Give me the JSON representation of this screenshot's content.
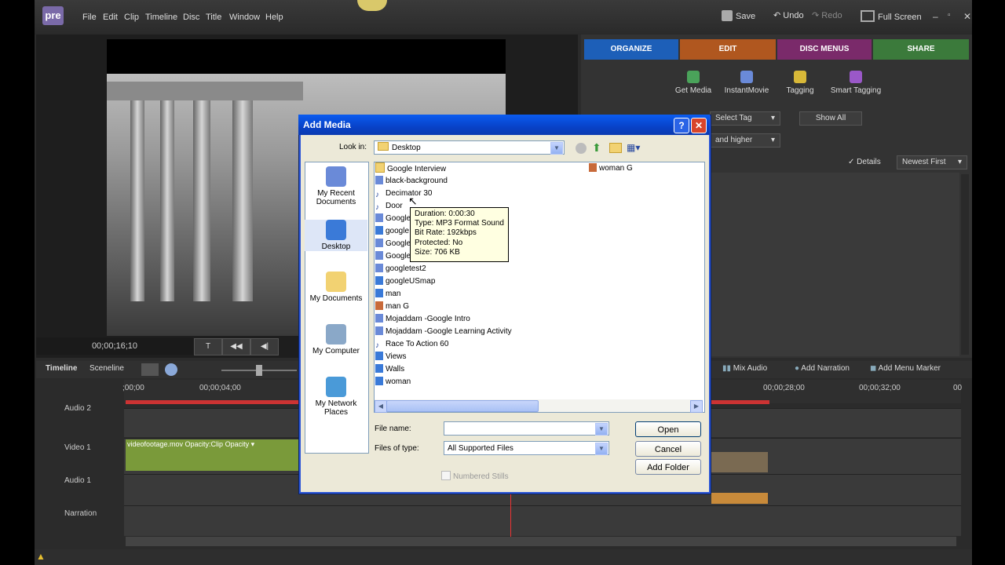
{
  "menu": [
    "File",
    "Edit",
    "Clip",
    "Timeline",
    "Disc",
    "Title",
    "Window",
    "Help"
  ],
  "logo": "pre",
  "toolbar": {
    "save": "Save",
    "undo": "Undo",
    "redo": "Redo",
    "fullscreen": "Full Screen"
  },
  "monitor": {
    "timecode": "00;00;16;10"
  },
  "tabs": [
    {
      "label": "ORGANIZE",
      "color": "#1d5fb8"
    },
    {
      "label": "EDIT",
      "color": "#b0571f"
    },
    {
      "label": "DISC MENUS",
      "color": "#7a2a6a"
    },
    {
      "label": "SHARE",
      "color": "#3b7a3b"
    }
  ],
  "organize_tools": [
    "Get Media",
    "InstantMovie",
    "Tagging",
    "Smart Tagging"
  ],
  "filters": {
    "select_tag": "Select Tag",
    "show_all": "Show All",
    "rating": "and higher",
    "details": "Details",
    "sort": "Newest First"
  },
  "timeline": {
    "tabs": [
      "Timeline",
      "Sceneline"
    ],
    "actions": [
      "Mix Audio",
      "Add Narration",
      "Add Menu Marker"
    ],
    "ruler": [
      ";00;00",
      "00;00;04;00",
      "00;00;28;00",
      "00;00;32;00",
      "00"
    ],
    "tracks": [
      "Audio 2",
      "Video 1",
      "Audio 1",
      "Narration"
    ],
    "clip_label": "videofootage.mov  Opacity:Clip Opacity ▾"
  },
  "dialog": {
    "title": "Add Media",
    "look_in_label": "Look in:",
    "look_in_value": "Desktop",
    "places": [
      "My Recent Documents",
      "Desktop",
      "My Documents",
      "My Computer",
      "My Network Places"
    ],
    "files_col1": [
      "Google Interview",
      "black-background",
      "Decimator 30",
      "Door",
      "Google",
      "google",
      "Google",
      "Google",
      "googletest2",
      "googleUSmap",
      "man",
      "man G",
      "Mojaddam -Google Intro",
      "Mojaddam -Google Learning Activity",
      "Race To Action 60",
      "Views",
      "Walls",
      "woman"
    ],
    "files_col2": [
      "woman G"
    ],
    "tooltip": [
      "Duration: 0:00:30",
      "Type: MP3 Format Sound",
      "Bit Rate: 192kbps",
      "Protected: No",
      "Size: 706 KB"
    ],
    "file_name_label": "File name:",
    "file_name_value": "",
    "files_of_type_label": "Files of type:",
    "files_of_type_value": "All Supported Files",
    "numbered_stills": "Numbered Stills",
    "open": "Open",
    "cancel": "Cancel",
    "add_folder": "Add Folder"
  }
}
